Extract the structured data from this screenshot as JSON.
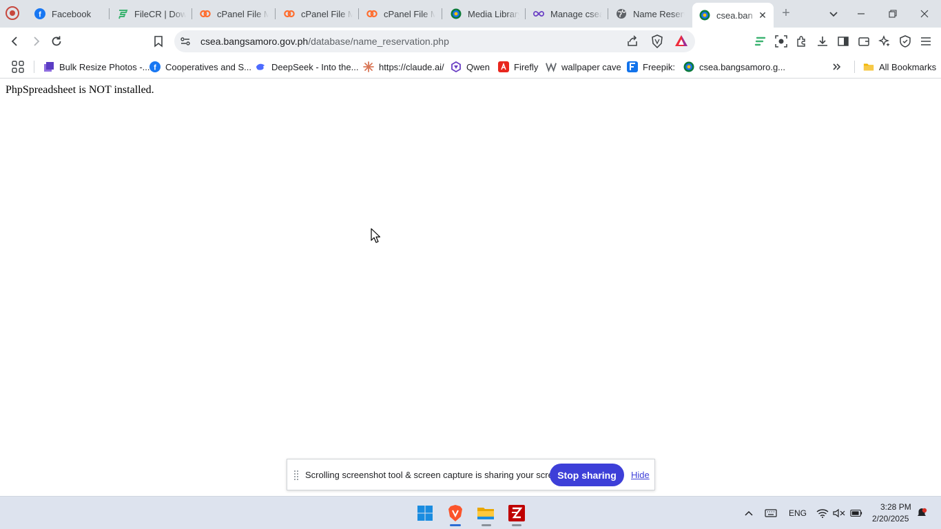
{
  "browser": {
    "tabs": [
      {
        "title": "Facebook",
        "icon": "facebook-icon",
        "color": "#1877f2"
      },
      {
        "title": "FileCR | Down",
        "icon": "filecr-icon",
        "color": "#3cb371"
      },
      {
        "title": "cPanel File M",
        "icon": "cpanel-icon",
        "color": "#ff6c2c"
      },
      {
        "title": "cPanel File M",
        "icon": "cpanel-icon",
        "color": "#ff6c2c"
      },
      {
        "title": "cPanel File M",
        "icon": "cpanel-icon",
        "color": "#ff6c2c"
      },
      {
        "title": "Media Library",
        "icon": "site-icon",
        "color": "#1a73e8"
      },
      {
        "title": "Manage csea",
        "icon": "infinity-icon",
        "color": "#6a3fc4"
      },
      {
        "title": "Name Reserv",
        "icon": "globe-icon",
        "color": "#5f6368"
      },
      {
        "title": "csea.ban",
        "icon": "site-icon",
        "color": "#1a73e8",
        "active": true
      }
    ],
    "address": {
      "host": "csea.bangsamoro.gov.ph",
      "path": "/database/name_reservation.php"
    },
    "bookmarks": [
      {
        "label": "Bulk Resize Photos -...",
        "icon": "bulk-resize-icon",
        "color": "#6a5acd"
      },
      {
        "label": "Cooperatives and S...",
        "icon": "facebook-icon",
        "color": "#1877f2"
      },
      {
        "label": "DeepSeek - Into the...",
        "icon": "deepseek-icon",
        "color": "#4d6bfe"
      },
      {
        "label": "https://claude.ai/",
        "icon": "claude-icon",
        "color": "#d97757"
      },
      {
        "label": "Qwen",
        "icon": "qwen-icon",
        "color": "#6a3fc4"
      },
      {
        "label": "Firefly",
        "icon": "firefly-icon",
        "color": "#e8271e"
      },
      {
        "label": "wallpaper cave",
        "icon": "wallpaper-cave-icon",
        "color": "#5f6368"
      },
      {
        "label": "Freepik:",
        "icon": "freepik-icon",
        "color": "#1273eb"
      },
      {
        "label": "csea.bangsamoro.g...",
        "icon": "site-icon",
        "color": "#1a73e8"
      }
    ],
    "all_bookmarks_label": "All Bookmarks"
  },
  "page": {
    "message": "PhpSpreadsheet is NOT installed."
  },
  "share_bar": {
    "message": "Scrolling screenshot tool & screen capture is sharing your screen.",
    "stop_label": "Stop sharing",
    "hide_label": "Hide"
  },
  "taskbar": {
    "language": "ENG",
    "time": "3:28 PM",
    "date": "2/20/2025"
  }
}
